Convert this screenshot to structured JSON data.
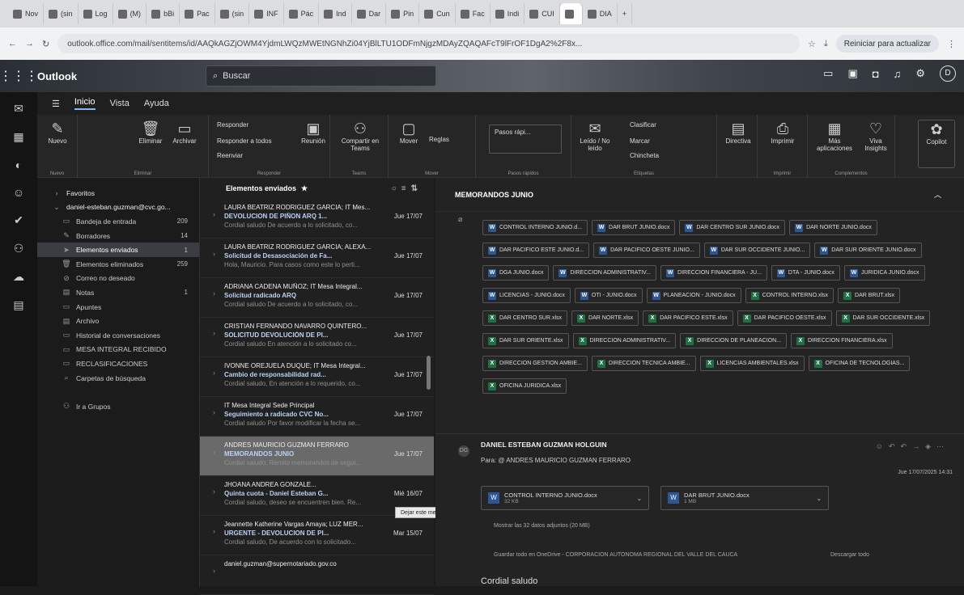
{
  "browser": {
    "tabs": [
      "Nov",
      "(sin",
      "Log",
      "(M)",
      "bBi",
      "Pac",
      "(sin",
      "INF",
      "Pác",
      "Ind",
      "Dar",
      "Pin",
      "Cun",
      "Fac",
      "Indi",
      "CUI",
      "",
      "DIA"
    ],
    "new_tab": "+",
    "url": "outlook.office.com/mail/sentitems/id/AAQkAGZjOWM4YjdmLWQzMWEtNGNhZi04YjBlLTU1ODFmNjgzMDAyZQAQAFcT9lFrOF1DgA2%2F8x...",
    "reload_label": "Reiniciar para actualizar"
  },
  "header": {
    "brand": "Outlook",
    "search_placeholder": "Buscar"
  },
  "ribbon_tabs": [
    "Inicio",
    "Vista",
    "Ayuda"
  ],
  "ribbon": {
    "nuevo": "Nuevo",
    "nuevo_group": "Nuevo",
    "eliminar": "Eliminar",
    "archivar": "Archivar",
    "eliminar_group": "Eliminar",
    "responder": "Responder",
    "responder_todos": "Responder a todos",
    "reenviar": "Reenviar",
    "reunion": "Reunión",
    "responder_group": "Responder",
    "compartir": "Compartir en Teams",
    "teams_group": "Teams",
    "mover": "Mover",
    "reglas": "Reglas",
    "mover_group": "Mover",
    "pasos": "Pasos rápi...",
    "pasos_group": "Pasos rápidos",
    "leido": "Leído / No leído",
    "clasificar": "Clasificar",
    "marcar": "Marcar",
    "chincheta": "Chincheta",
    "etiquetas_group": "Etiquetas",
    "directiva": "Directiva",
    "imprimir": "Imprimir",
    "imprimir_group": "Imprimir",
    "mas_apps": "Más aplicaciones",
    "viva": "Viva Insights",
    "complementos_group": "Complementos",
    "copilot": "Copilot"
  },
  "folders": [
    {
      "label": "Favoritos",
      "count": "",
      "icon": "chevron-right",
      "type": "hdr"
    },
    {
      "label": "daniel-esteban.guzman@cvc.go...",
      "count": "",
      "icon": "chevron-down",
      "type": "hdr"
    },
    {
      "label": "Bandeja de entrada",
      "count": "209",
      "icon": "inbox"
    },
    {
      "label": "Borradores",
      "count": "14",
      "icon": "pencil"
    },
    {
      "label": "Elementos enviados",
      "count": "1",
      "icon": "send",
      "type": "sel"
    },
    {
      "label": "Elementos eliminados",
      "count": "259",
      "icon": "trash"
    },
    {
      "label": "Correo no deseado",
      "count": "",
      "icon": "junk"
    },
    {
      "label": "Notas",
      "count": "1",
      "icon": "note"
    },
    {
      "label": "Apuntes",
      "count": "",
      "icon": "folder"
    },
    {
      "label": "Archivo",
      "count": "",
      "icon": "archive"
    },
    {
      "label": "Historial de conversaciones",
      "count": "",
      "icon": "folder"
    },
    {
      "label": "MESA INTEGRAL RECIBIDO",
      "count": "",
      "icon": "folder"
    },
    {
      "label": "RECLASIFICACIONES",
      "count": "",
      "icon": "folder"
    },
    {
      "label": "Carpetas de búsqueda",
      "count": "",
      "icon": "search-folder"
    },
    {
      "label": "",
      "count": "",
      "icon": "",
      "type": "spacer"
    },
    {
      "label": "Ir a Grupos",
      "count": "",
      "icon": "groups"
    }
  ],
  "message_list": {
    "title": "Elementos enviados",
    "messages": [
      {
        "from": "LAURA BEATRIZ RODRIGUEZ GARCIA; IT Mes...",
        "subject": "DEVOLUCION DE PIÑON ARQ 1...",
        "date": "Jue 17/07",
        "preview": "Cordial saludo De acuerdo a lo solicitado, co..."
      },
      {
        "from": "LAURA BEATRIZ RODRIGUEZ GARCIA; ALEXA...",
        "subject": "Solicitud de Desasociación de Fa...",
        "date": "Jue 17/07",
        "preview": "Hola, Mauricio. Para casos como este lo perti..."
      },
      {
        "from": "ADRIANA CADENA MUÑOZ; IT Mesa Integral...",
        "subject": "Solicitud radicado ARQ",
        "date": "Jue 17/07",
        "preview": "Cordial saludo De acuerdo a lo solicitado, co..."
      },
      {
        "from": "CRISTIAN FERNANDO NAVARRO QUINTERO...",
        "subject": "SOLICITUD DEVOLUCIÓN DE PI...",
        "date": "Jue 17/07",
        "preview": "Cordial saludo En atención a lo solicitado co..."
      },
      {
        "from": "IVONNE OREJUELA DUQUE; IT Mesa Integral...",
        "subject": "Cambio de responsabilidad rad...",
        "date": "Jue 17/07",
        "preview": "Cordial saludo, En atención a lo requerido, co..."
      },
      {
        "from": "IT Mesa Integral Sede Principal",
        "subject": "Seguimiento a radicado CVC No...",
        "date": "Jue 17/07",
        "preview": "Cordial saludo Por favor modificar la fecha se..."
      },
      {
        "from": "ANDRES MAURICIO GUZMAN FERRARO",
        "subject": "MEMORANDOS JUNIO",
        "date": "Jue 17/07",
        "preview": "Cordial saludo, Remito memorandos de segui..."
      },
      {
        "from": "JHOANA ANDREA GONZALE...",
        "subject": "Quinta cuota - Daniel Esteban G...",
        "date": "Mié 16/07",
        "preview": "Cordial saludo, deseo se encuentren bien. Re..."
      },
      {
        "from": "Jeannette Katherine Vargas Amaya; LUZ MER...",
        "subject": "URGENTE - DEVOLUCION DE PI...",
        "date": "Mar 15/07",
        "preview": "Cordial saludo, De acuerdo con lo solicitado..."
      },
      {
        "from": "daniel.guzman@supernotariado.gov.co",
        "subject": "",
        "date": "",
        "preview": ""
      }
    ],
    "tooltip": "Dejar este mensaje en la parte superior de la carpeta"
  },
  "reading": {
    "subject": "MEMORANDOS JUNIO",
    "attachments": [
      {
        "name": "CONTROL INTERNO JUNIO.d...",
        "kind": "word"
      },
      {
        "name": "DAR BRUT JUNIO.docx",
        "kind": "word"
      },
      {
        "name": "DAR CENTRO SUR JUNIO.docx",
        "kind": "word"
      },
      {
        "name": "DAR NORTE JUNIO.docx",
        "kind": "word"
      },
      {
        "name": "DAR PACIFICO ESTE JUNIO.d...",
        "kind": "word"
      },
      {
        "name": "DAR PACIFICO OESTE JUNIO...",
        "kind": "word"
      },
      {
        "name": "DAR SUR OCCIDENTE JUNIO...",
        "kind": "word"
      },
      {
        "name": "DAR SUR ORIENTE JUNIO.docx",
        "kind": "word"
      },
      {
        "name": "DGA JUNIO.docx",
        "kind": "word"
      },
      {
        "name": "DIRECCION ADMINISTRATIV...",
        "kind": "word"
      },
      {
        "name": "DIRECCION FINANCIERA - JU...",
        "kind": "word"
      },
      {
        "name": "DTA - JUNIO.docx",
        "kind": "word"
      },
      {
        "name": "JURIDICA JUNIO.docx",
        "kind": "word"
      },
      {
        "name": "LICENCIAS - JUNIO.docx",
        "kind": "word"
      },
      {
        "name": "OTI - JUNIO.docx",
        "kind": "word"
      },
      {
        "name": "PLANEACION - JUNIO.docx",
        "kind": "word"
      },
      {
        "name": "CONTROL INTERNO.xlsx",
        "kind": "excel"
      },
      {
        "name": "DAR BRUT.xlsx",
        "kind": "excel"
      },
      {
        "name": "DAR CENTRO SUR.xlsx",
        "kind": "excel"
      },
      {
        "name": "DAR NORTE.xlsx",
        "kind": "excel"
      },
      {
        "name": "DAR PACIFICO ESTE.xlsx",
        "kind": "excel"
      },
      {
        "name": "DAR PACIFICO OESTE.xlsx",
        "kind": "excel"
      },
      {
        "name": "DAR SUR OCCIDENTE.xlsx",
        "kind": "excel"
      },
      {
        "name": "DAR SUR ORIENTE.xlsx",
        "kind": "excel"
      },
      {
        "name": "DIRECCION ADMINISTRATIV...",
        "kind": "excel"
      },
      {
        "name": "DIRECCION DE PLANEACION...",
        "kind": "excel"
      },
      {
        "name": "DIRECCION FINANCIERA.xlsx",
        "kind": "excel"
      },
      {
        "name": "DIRECCION GESTION AMBIE...",
        "kind": "excel"
      },
      {
        "name": "DIRECCION TECNICA AMBIE...",
        "kind": "excel"
      },
      {
        "name": "LICENCIAS AMBIENTALES.xlsx",
        "kind": "excel"
      },
      {
        "name": "OFICINA DE TECNOLOGIAS...",
        "kind": "excel"
      },
      {
        "name": "OFICINA JURIDICA.xlsx",
        "kind": "excel"
      }
    ],
    "email2": {
      "sender": "DANIEL ESTEBAN GUZMAN HOLGUIN",
      "to": "Para: @ ANDRES MAURICIO GUZMAN FERRARO",
      "date": "Jue 17/07/2025 14:31",
      "att1_name": "CONTROL INTERNO JUNIO.docx",
      "att1_size": "32 KB",
      "att2_name": "DAR BRUT JUNIO.docx",
      "att2_size": "1 MB",
      "show_all": "Mostrar las 32 datos adjuntos (20 MB)",
      "save_onedrive": "Guardar todo en OneDrive - CORPORACION AUTONOMA REGIONAL DEL VALLE DEL CAUCA",
      "download_all": "Descargar todo",
      "greeting": "Cordial saludo"
    }
  }
}
